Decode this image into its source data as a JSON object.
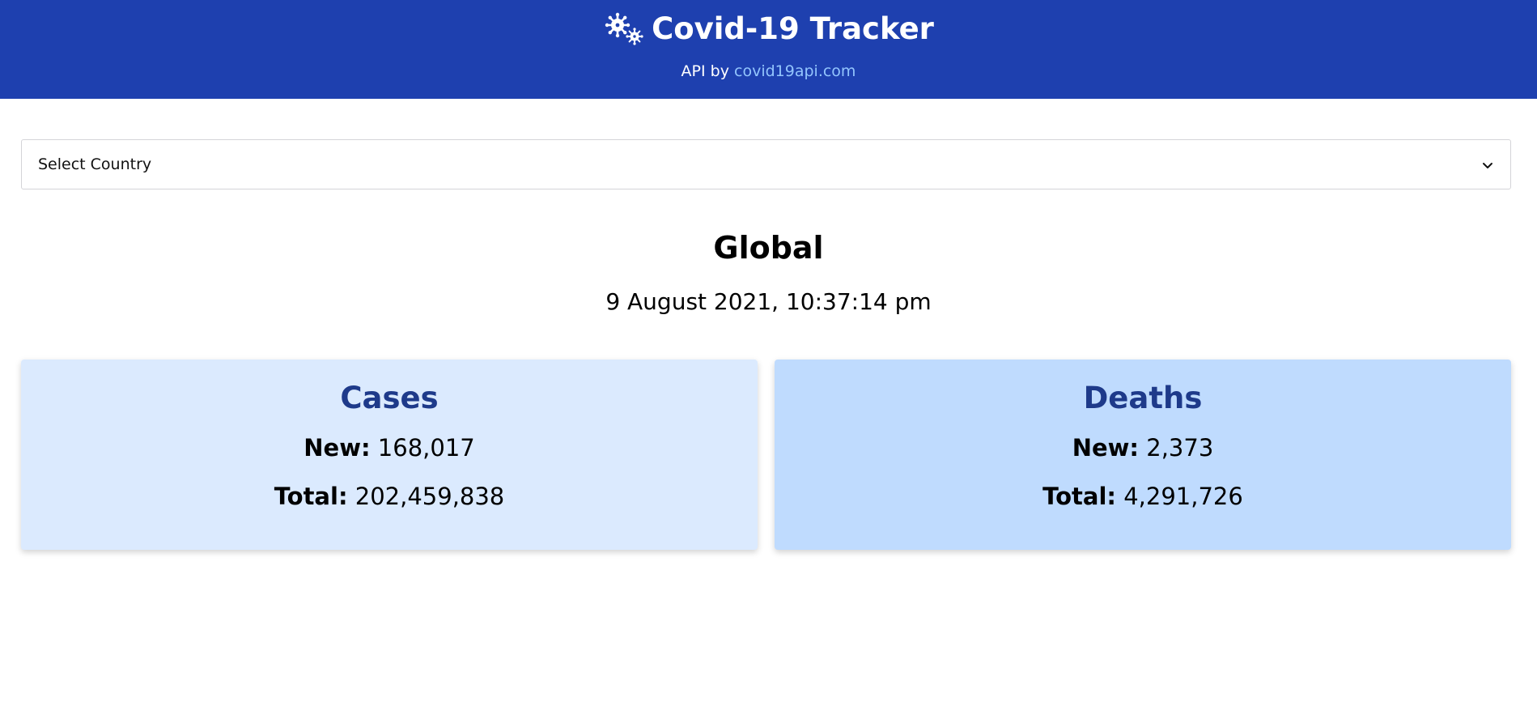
{
  "header": {
    "title": "Covid-19 Tracker",
    "icon": "virus-icon",
    "api_prefix": "API by",
    "api_link_text": "covid19api.com"
  },
  "country_select": {
    "selected": "Select Country"
  },
  "summary": {
    "region": "Global",
    "timestamp": "9 August 2021, 10:37:14 pm"
  },
  "cards": {
    "cases": {
      "title": "Cases",
      "new_label": "New:",
      "new_value": "168,017",
      "total_label": "Total:",
      "total_value": "202,459,838"
    },
    "deaths": {
      "title": "Deaths",
      "new_label": "New:",
      "new_value": "2,373",
      "total_label": "Total:",
      "total_value": "4,291,726"
    }
  },
  "colors": {
    "header_bg": "#1e40af",
    "link": "#93c5fd",
    "cases_card_bg": "#dbeafe",
    "deaths_card_bg": "#bfdbfe",
    "card_title": "#1e3a8a"
  }
}
